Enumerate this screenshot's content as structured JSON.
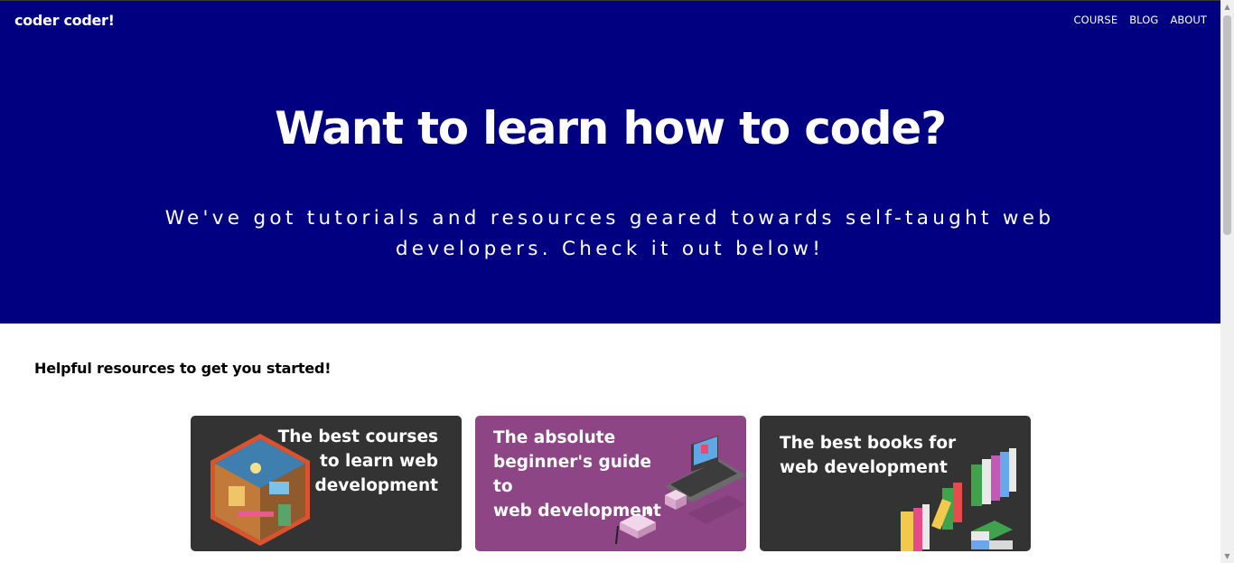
{
  "header": {
    "logo": "coder coder!",
    "nav": [
      {
        "label": "COURSE"
      },
      {
        "label": "BLOG"
      },
      {
        "label": "ABOUT"
      }
    ]
  },
  "hero": {
    "title": "Want to learn how to code?",
    "subtitle": "We've got tutorials and resources geared towards self-taught web developers. Check it out below!"
  },
  "resources": {
    "heading": "Helpful resources to get you started!",
    "cards": [
      {
        "title": "The best courses\nto learn web\ndevelopment",
        "icon": "isometric-room-illustration"
      },
      {
        "title": "The absolute\nbeginner's guide to\nweb development",
        "icon": "isometric-laptop-illustration"
      },
      {
        "title": "The best books for\nweb development",
        "icon": "isometric-books-illustration"
      }
    ]
  },
  "colors": {
    "hero_bg": "#000080",
    "card_dark": "#333333",
    "card_purple": "#8e4585"
  }
}
